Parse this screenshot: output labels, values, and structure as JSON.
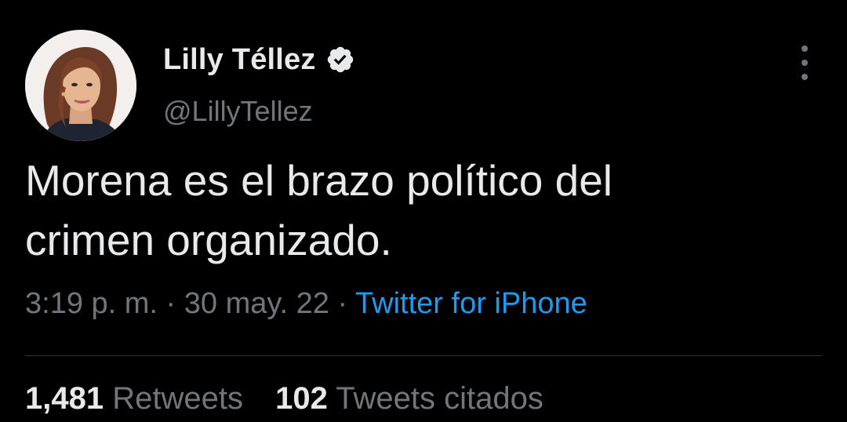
{
  "tweet": {
    "author": {
      "display_name": "Lilly Téllez",
      "handle": "@LillyTellez",
      "verified": true,
      "avatar_icon": "profile-photo"
    },
    "text_lines": [
      "Morena es el brazo político del",
      "crimen organizado."
    ],
    "time": "3:19 p. m.",
    "separator": "·",
    "date": "30 may. 22",
    "source": "Twitter for iPhone",
    "stats": {
      "retweets_count": "1,481",
      "retweets_label": "Retweets",
      "quotes_count": "102",
      "quotes_label": "Tweets citados"
    },
    "more_icon": "more-vertical-icon"
  },
  "colors": {
    "background": "#000000",
    "primary_text": "#e7e9ea",
    "secondary_text": "#71767b",
    "accent": "#1d9bf0",
    "divider": "#2f3336"
  }
}
